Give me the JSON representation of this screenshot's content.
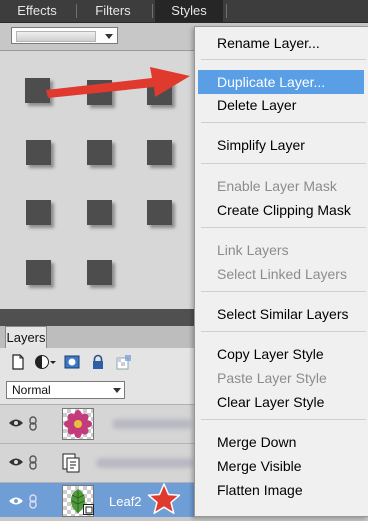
{
  "tabs": [
    {
      "label": "Effects"
    },
    {
      "label": "Filters"
    },
    {
      "label": "Styles",
      "active": true
    }
  ],
  "layers_panel": {
    "tab_label": "Layers",
    "blend_mode": "Normal",
    "layers": [
      {
        "name": "",
        "visible": true,
        "thumbnail": "flower-thumbnail",
        "selected": false
      },
      {
        "name": "",
        "visible": true,
        "thumbnail": "document-thumbnail",
        "selected": false
      },
      {
        "name": "Leaf2",
        "visible": true,
        "thumbnail": "leaf-thumbnail",
        "selected": true
      }
    ]
  },
  "context_menu": {
    "groups": [
      [
        {
          "label": "Rename Layer...",
          "enabled": true
        }
      ],
      [
        {
          "label": "Duplicate Layer...",
          "enabled": true,
          "highlighted": true
        },
        {
          "label": "Delete Layer",
          "enabled": true
        }
      ],
      [
        {
          "label": "Simplify Layer",
          "enabled": true
        }
      ],
      [
        {
          "label": "Enable Layer Mask",
          "enabled": false
        },
        {
          "label": "Create Clipping Mask",
          "enabled": true
        }
      ],
      [
        {
          "label": "Link Layers",
          "enabled": false
        },
        {
          "label": "Select Linked Layers",
          "enabled": false
        }
      ],
      [
        {
          "label": "Select Similar Layers",
          "enabled": true
        }
      ],
      [
        {
          "label": "Copy Layer Style",
          "enabled": true
        },
        {
          "label": "Paste Layer Style",
          "enabled": false
        },
        {
          "label": "Clear Layer Style",
          "enabled": true
        }
      ],
      [
        {
          "label": "Merge Down",
          "enabled": true
        },
        {
          "label": "Merge Visible",
          "enabled": true
        },
        {
          "label": "Flatten Image",
          "enabled": true
        }
      ]
    ]
  },
  "colors": {
    "menu_highlight": "#5a9ee6",
    "selected_layer": "#6f9ed6",
    "annotation_arrow": "#e03a2f",
    "annotation_star": "#e03a2f"
  },
  "icons": [
    "new-layer-icon",
    "fill-adjustment-icon",
    "layer-mask-icon",
    "lock-icon",
    "lock-transparency-icon",
    "eye-icon",
    "link-icon",
    "chevron-down-icon",
    "arrow-annotation",
    "star-annotation"
  ]
}
